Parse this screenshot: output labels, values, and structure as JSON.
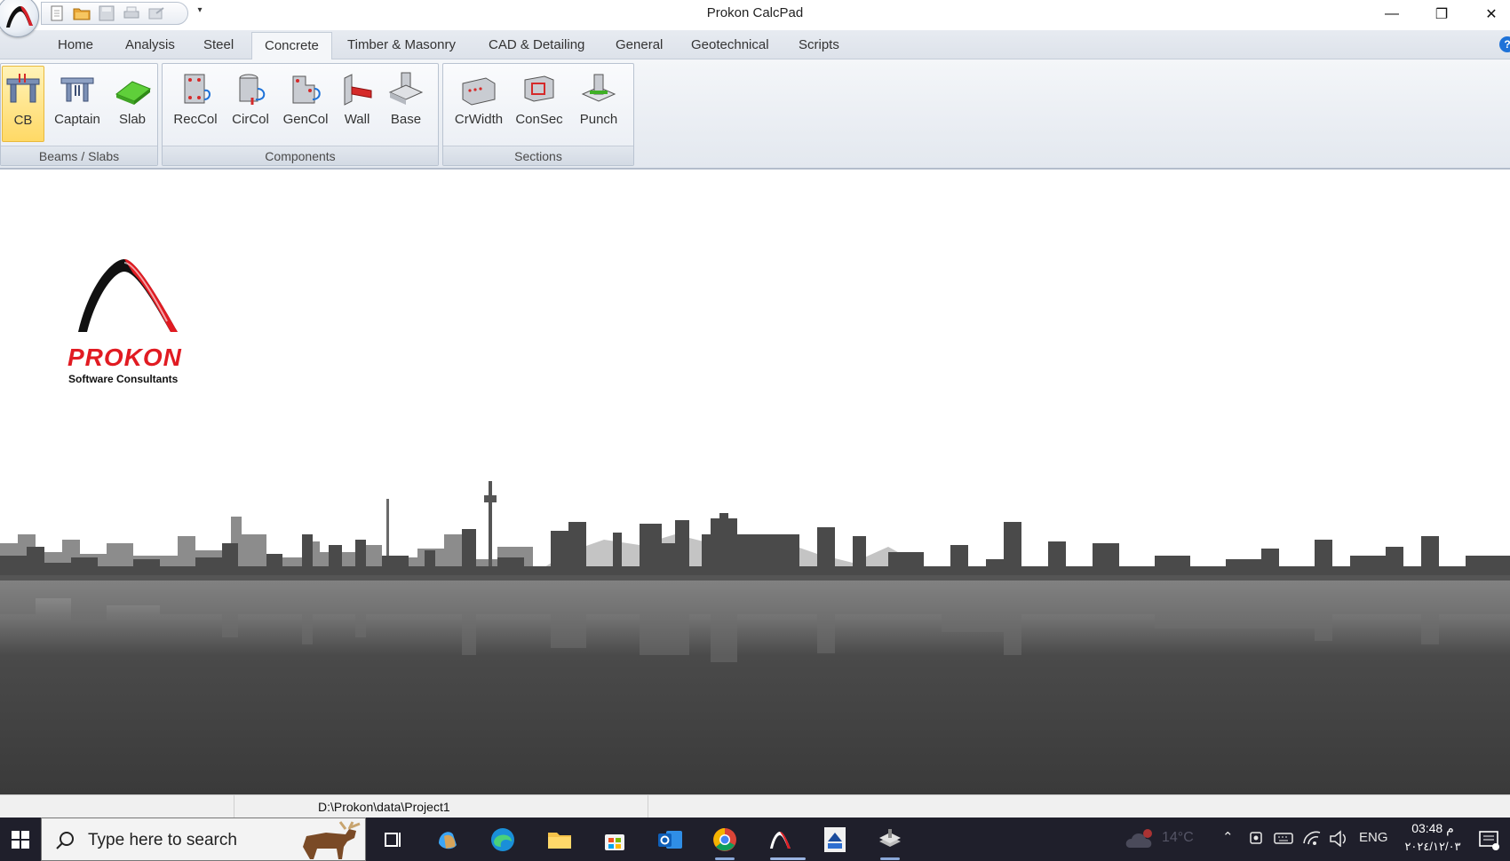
{
  "window": {
    "title": "Prokon CalcPad",
    "minimize_glyph": "—",
    "maximize_glyph": "❐",
    "close_glyph": "✕"
  },
  "quick_access": {
    "more_glyph": "▾",
    "icons": [
      "new-file-icon",
      "open-folder-icon",
      "save-icon",
      "print-icon",
      "export-icon"
    ]
  },
  "ribbon_tabs": [
    "Home",
    "Analysis",
    "Steel",
    "Concrete",
    "Timber & Masonry",
    "CAD & Detailing",
    "General",
    "Geotechnical",
    "Scripts"
  ],
  "active_tab": "Concrete",
  "ribbon_groups": [
    {
      "label": "Beams / Slabs",
      "buttons": [
        "CB",
        "Captain",
        "Slab"
      ]
    },
    {
      "label": "Components",
      "buttons": [
        "RecCol",
        "CirCol",
        "GenCol",
        "Wall",
        "Base"
      ]
    },
    {
      "label": "Sections",
      "buttons": [
        "CrWidth",
        "ConSec",
        "Punch"
      ]
    }
  ],
  "active_button": "CB",
  "help_glyph": "?",
  "logo": {
    "name": "PROKON",
    "tagline": "Software Consultants",
    "brand_red": "#e11b22"
  },
  "status_bar": {
    "path": "D:\\Prokon\\data\\Project1"
  },
  "taskbar": {
    "search_placeholder": "Type here to search",
    "weather_temp": "14°C",
    "language": "ENG",
    "time": "03:48 م",
    "date": "٢٠٢٤/١٢/٠٣"
  },
  "colors": {
    "ribbon_bg": "#e7ebf1",
    "taskbar_bg": "#1f1f2b",
    "skyline_dark": "#3a3a3a"
  }
}
